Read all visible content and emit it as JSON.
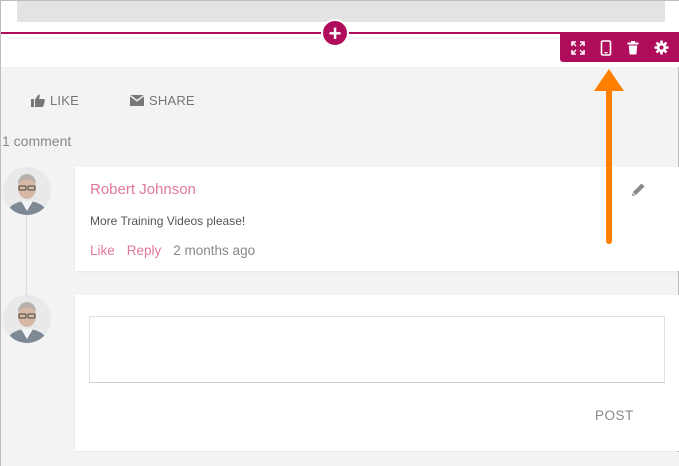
{
  "colors": {
    "accent": "#b00c5c",
    "link": "#e0779f",
    "arrow": "#ff8000"
  },
  "section": {
    "add_label": "+"
  },
  "toolbar": {
    "buttons": [
      {
        "icon": "expand-icon"
      },
      {
        "icon": "mobile-icon"
      },
      {
        "icon": "trash-icon"
      },
      {
        "icon": "gear-icon"
      }
    ]
  },
  "post_actions": {
    "like_label": "LIKE",
    "share_label": "SHARE"
  },
  "comments": {
    "count_label": "1 comment",
    "items": [
      {
        "author": "Robert Johnson",
        "text": "More Training Videos please!",
        "like_label": "Like",
        "reply_label": "Reply",
        "time": "2 months ago"
      }
    ],
    "reply": {
      "placeholder": "",
      "post_label": "POST"
    }
  }
}
